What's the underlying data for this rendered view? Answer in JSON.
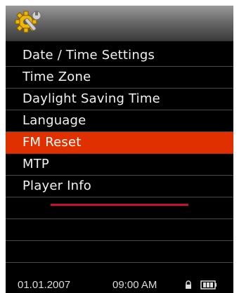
{
  "header": {
    "icon": "settings-gear-wrench-icon"
  },
  "menu": {
    "items": [
      {
        "label": "Date / Time Settings",
        "selected": false
      },
      {
        "label": "Time Zone",
        "selected": false
      },
      {
        "label": "Daylight Saving Time",
        "selected": false
      },
      {
        "label": "Language",
        "selected": false
      },
      {
        "label": "FM Reset",
        "selected": true
      },
      {
        "label": "MTP",
        "selected": false
      },
      {
        "label": "Player Info",
        "selected": false
      }
    ],
    "selected_index": 4
  },
  "status": {
    "date": "01.01.2007",
    "time": "09:00 AM",
    "lock_icon": "lock-icon",
    "battery_icon": "battery-icon"
  },
  "colors": {
    "selection": "#e03000",
    "scroll_indicator": "#c8102e",
    "text": "#f2f2f2",
    "background": "#000000",
    "icon_gold": "#f0b800"
  }
}
